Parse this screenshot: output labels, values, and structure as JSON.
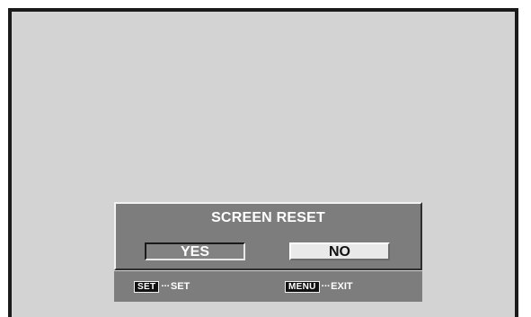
{
  "dialog": {
    "title": "SCREEN RESET",
    "options": [
      {
        "label": "YES",
        "selected": true
      },
      {
        "label": "NO",
        "selected": false
      }
    ]
  },
  "footer": {
    "set_key": "SET",
    "set_action": "SET",
    "menu_key": "MENU",
    "menu_action": "EXIT",
    "separator": "···"
  },
  "colors": {
    "screen_background": "#d3d3d3",
    "dialog_background": "#7d7d7d",
    "selected_option": "#828282",
    "unselected_option": "#e9e9e9",
    "key_background": "#111111"
  }
}
